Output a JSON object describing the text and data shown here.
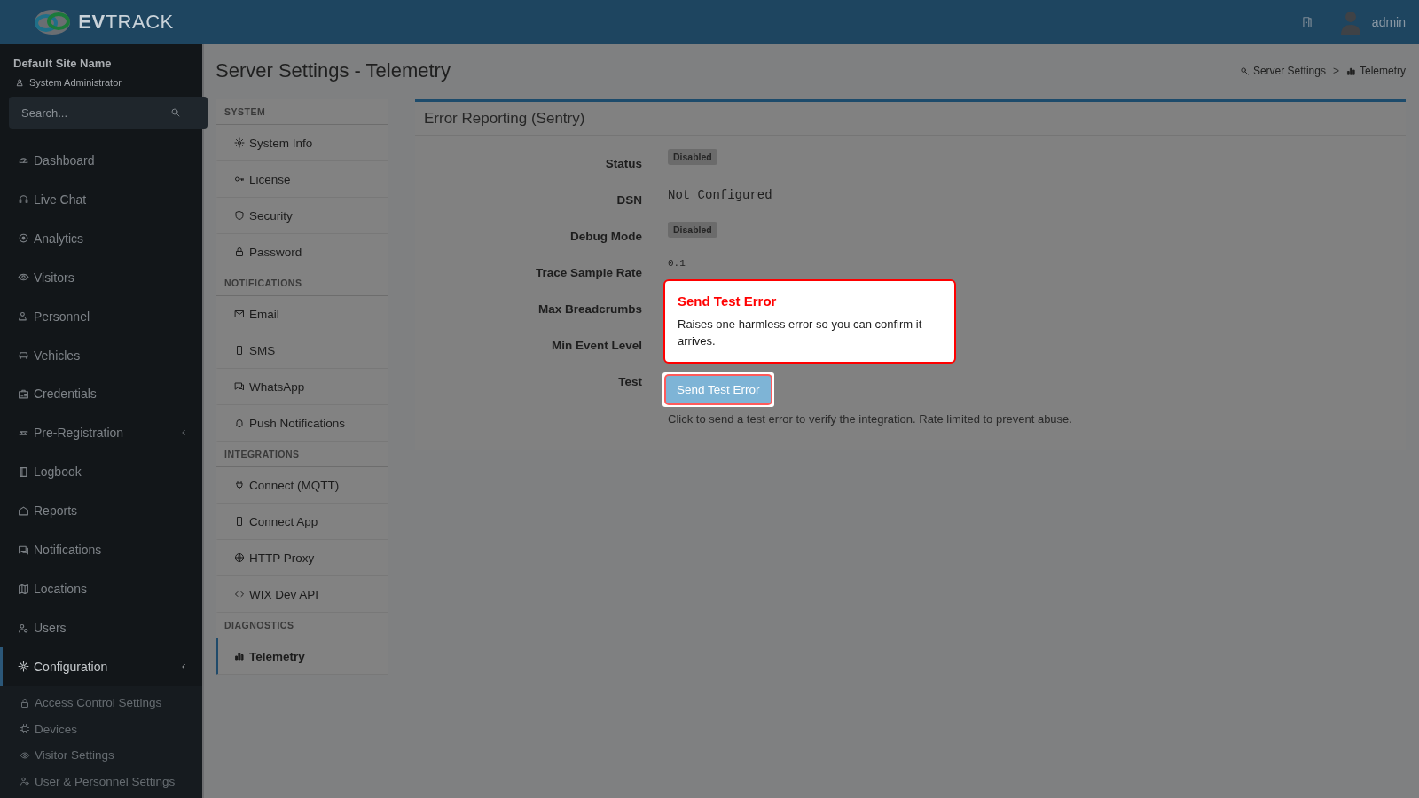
{
  "header": {
    "logo": "**EV**TRACK",
    "user": "admin"
  },
  "sidebar": {
    "site_name": "Default Site Name",
    "role": "System Administrator",
    "search": {
      "placeholder": "Search..."
    },
    "items": [
      {
        "label": "Dashboard",
        "kind": "link",
        "selected": false
      },
      {
        "label": "Live Chat",
        "kind": "link",
        "selected": false
      },
      {
        "label": "Analytics",
        "kind": "link",
        "selected": false
      },
      {
        "label": "Visitors",
        "kind": "link",
        "selected": false
      },
      {
        "label": "Personnel",
        "kind": "link",
        "selected": false
      },
      {
        "label": "Vehicles",
        "kind": "link",
        "selected": false
      },
      {
        "label": "Credentials",
        "kind": "link",
        "selected": false
      },
      {
        "label": "Pre-Registration",
        "kind": "group",
        "selected": false
      },
      {
        "label": "Logbook",
        "kind": "link",
        "selected": false
      },
      {
        "label": "Reports",
        "kind": "link",
        "selected": false
      },
      {
        "label": "Notifications",
        "kind": "link",
        "selected": false
      },
      {
        "label": "Locations",
        "kind": "link",
        "selected": false
      },
      {
        "label": "Users",
        "kind": "link",
        "selected": false
      },
      {
        "label": "Configuration",
        "kind": "group",
        "selected": true,
        "children": [
          {
            "label": "Access Control Settings"
          },
          {
            "label": "Devices"
          },
          {
            "label": "Visitor Settings"
          },
          {
            "label": "User & Personnel Settings"
          }
        ]
      }
    ]
  },
  "page": {
    "title": "Server Settings - Telemetry",
    "breadcrumb": {
      "items": [
        "Server Settings",
        "Telemetry"
      ],
      "separator": ">"
    }
  },
  "settings_menu": [
    {
      "title": "SYSTEM",
      "items": [
        {
          "label": "System Info",
          "selected": false
        },
        {
          "label": "License",
          "selected": false
        },
        {
          "label": "Security",
          "selected": false
        },
        {
          "label": "Password",
          "selected": false
        }
      ]
    },
    {
      "title": "NOTIFICATIONS",
      "items": [
        {
          "label": "Email",
          "selected": false
        },
        {
          "label": "SMS",
          "selected": false
        },
        {
          "label": "WhatsApp",
          "selected": false
        },
        {
          "label": "Push Notifications",
          "selected": false
        }
      ]
    },
    {
      "title": "INTEGRATIONS",
      "items": [
        {
          "label": "Connect (MQTT)",
          "selected": false
        },
        {
          "label": "Connect App",
          "selected": false
        },
        {
          "label": "HTTP Proxy",
          "selected": false
        },
        {
          "label": "WIX Dev API",
          "selected": false
        }
      ]
    },
    {
      "title": "DIAGNOSTICS",
      "items": [
        {
          "label": "Telemetry",
          "selected": true
        }
      ]
    }
  ],
  "card": {
    "title": "Error Reporting (Sentry)",
    "fields": [
      {
        "label": "Status",
        "kind": "badge",
        "value": "Disabled"
      },
      {
        "label": "DSN",
        "kind": "mono",
        "value": "Not Configured"
      },
      {
        "label": "Debug Mode",
        "kind": "badge",
        "value": "Disabled"
      },
      {
        "label": "Trace Sample Rate",
        "kind": "mono_small",
        "value": "0.1"
      },
      {
        "label": "Max Breadcrumbs",
        "kind": "hidden"
      },
      {
        "label": "Min Event Level",
        "kind": "hidden"
      },
      {
        "label": "Test",
        "kind": "button",
        "value": "Send Test Error",
        "help": "Click to send a test error to verify the integration. Rate limited to prevent abuse."
      }
    ],
    "popover": {
      "title": "Send Test Error",
      "text": "Raises one harmless error so you can confirm it arrives."
    }
  }
}
